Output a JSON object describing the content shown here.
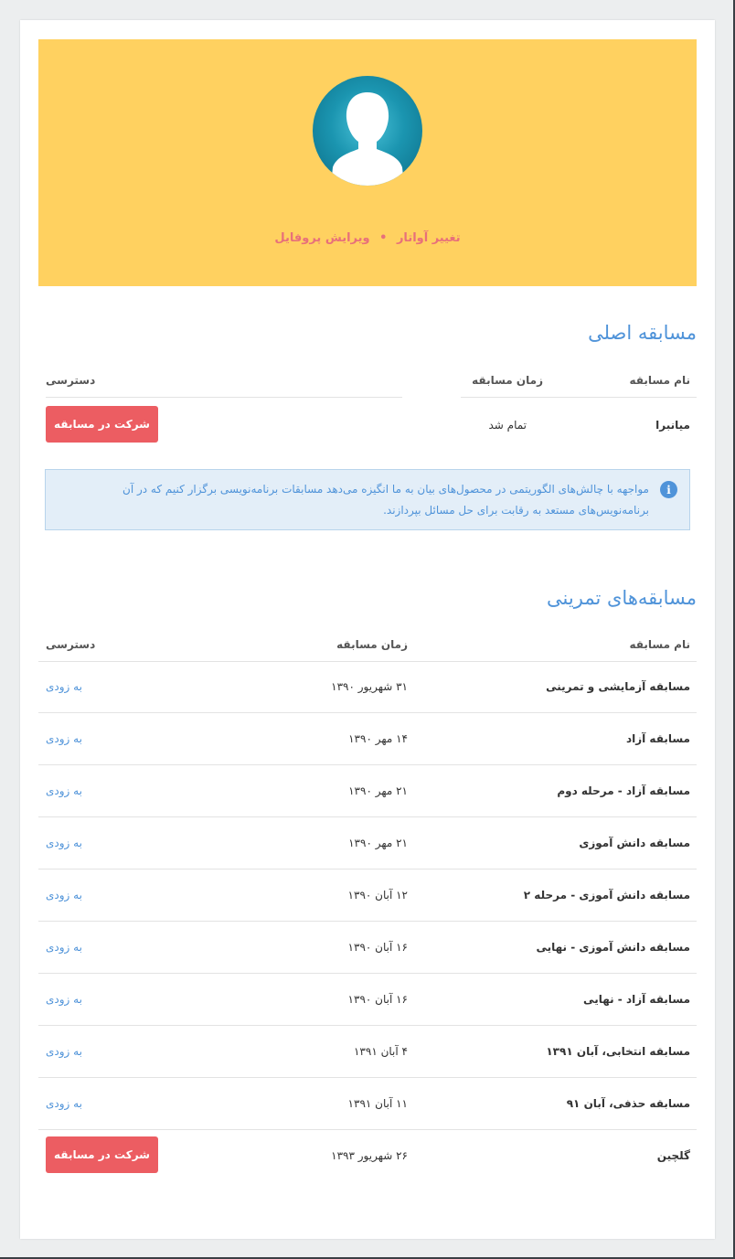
{
  "profile": {
    "change_avatar": "تغییر آواتار",
    "separator": "•",
    "edit_profile": "ویرایش پروفایل"
  },
  "main_contest": {
    "title": "مسابقه اصلی",
    "headers": {
      "name": "نام مسابقه",
      "time": "زمان مسابقه",
      "access": "دسترسی"
    },
    "row": {
      "name": "میانبرا",
      "time": "تمام شد",
      "action": "شرکت در مسابقه"
    },
    "info": "مواجهه با چالش‌های الگوریتمی در محصول‌های بیان به ما انگیزه می‌دهد مسابقات برنامه‌نویسی برگزار کنیم که در آن برنامه‌نویس‌های مستعد به رقابت برای حل مسائل بپردازند."
  },
  "practice_contests": {
    "title": "مسابقه‌های تمرینی",
    "headers": {
      "name": "نام مسابقه",
      "time": "زمان مسابقه",
      "access": "دسترسی"
    },
    "rows": [
      {
        "name": "مسابقه آزمایشی و تمرینی",
        "time": "۳۱ شهریور ۱۳۹۰",
        "access": "به زودی"
      },
      {
        "name": "مسابقه آزاد",
        "time": "۱۴ مهر ۱۳۹۰",
        "access": "به زودی"
      },
      {
        "name": "مسابقه آزاد - مرحله دوم",
        "time": "۲۱ مهر ۱۳۹۰",
        "access": "به زودی"
      },
      {
        "name": "مسابقه دانش آموزی",
        "time": "۲۱ مهر ۱۳۹۰",
        "access": "به زودی"
      },
      {
        "name": "مسابقه دانش آموزی - مرحله ۲",
        "time": "۱۲ آبان ۱۳۹۰",
        "access": "به زودی"
      },
      {
        "name": "مسابقه دانش آموزی - نهایی",
        "time": "۱۶ آبان ۱۳۹۰",
        "access": "به زودی"
      },
      {
        "name": "مسابقه آزاد - نهایی",
        "time": "۱۶ آبان ۱۳۹۰",
        "access": "به زودی"
      },
      {
        "name": "مسابقه انتخابی، آبان ۱۳۹۱",
        "time": "۴ آبان ۱۳۹۱",
        "access": "به زودی"
      },
      {
        "name": "مسابقه حذفی، آبان ۹۱",
        "time": "۱۱ آبان ۱۳۹۱",
        "access": "به زودی"
      },
      {
        "name": "گلچین",
        "time": "۲۶ شهریور ۱۳۹۳",
        "access": "شرکت در مسابقه"
      }
    ]
  },
  "colors": {
    "hero": "#ffd160",
    "accent": "#4f93d9",
    "button": "#ec5d62",
    "profile_link": "#e8707a"
  }
}
